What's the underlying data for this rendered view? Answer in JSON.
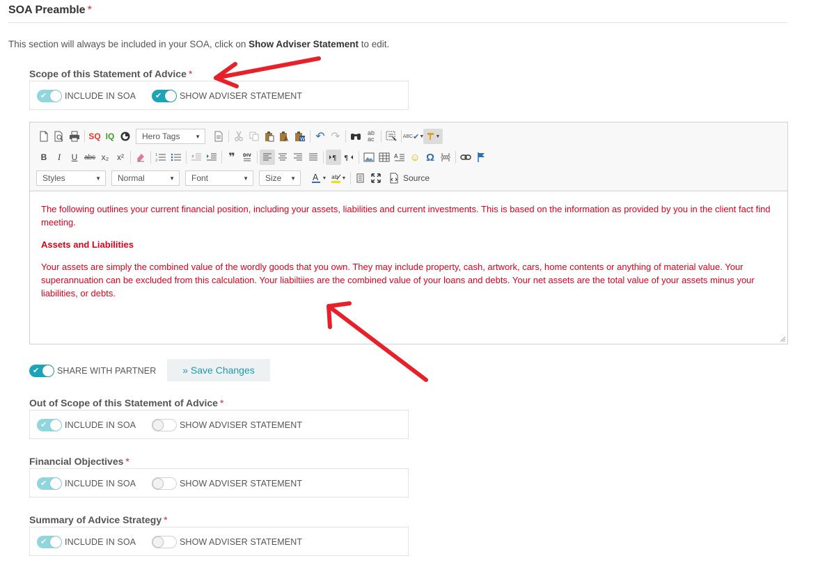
{
  "page": {
    "title": "SOA Preamble",
    "required_mark": "*",
    "intro_before": "This section will always be included in your SOA, click on ",
    "intro_bold": "Show Adviser Statement",
    "intro_after": " to edit."
  },
  "labels": {
    "include": "INCLUDE IN SOA",
    "show_adviser": "SHOW ADVISER STATEMENT",
    "share_partner": "SHARE WITH PARTNER",
    "save_changes": "» Save Changes"
  },
  "sections": [
    {
      "title": "Scope of this Statement of Advice",
      "include_in_soa": true,
      "show_adviser_statement": true
    },
    {
      "title": "Out of Scope of this Statement of Advice",
      "include_in_soa": true,
      "show_adviser_statement": false
    },
    {
      "title": "Financial Objectives",
      "include_in_soa": true,
      "show_adviser_statement": false
    },
    {
      "title": "Summary of Advice Strategy",
      "include_in_soa": true,
      "show_adviser_statement": false
    }
  ],
  "share_with_partner": true,
  "toolbar": {
    "sq": "SQ",
    "iq": "IQ",
    "hero_tags": "Hero Tags",
    "styles": "Styles",
    "format": "Normal",
    "font": "Font",
    "size": "Size",
    "source": "Source",
    "bold": "B",
    "italic": "I",
    "underline": "U",
    "strike": "abc",
    "sub": "x₂",
    "sup": "x²",
    "quote": "❞",
    "omega": "Ω",
    "spell": "ABC"
  },
  "editor": {
    "para1": "The following outlines your current financial position, including your assets, liabilities and current investments. This is based on the information as provided by you in the client fact find meeting.",
    "heading": "Assets and Liabilities",
    "para2": "Your assets are simply the combined value of the wordly goods that you own. They may include property, cash, artwork, cars, home contents or anything of material value. Your superannuation can be excluded from this calculation. Your liabiltiies are the combined value of your loans and debts. Your net assets are the total value of your assets minus your liabilities, or debts."
  },
  "colors": {
    "accent": "#1ca4b8",
    "toggle_light": "#8fd6df",
    "required": "#d9282f",
    "editor_text": "#e0001b",
    "annotation_arrow": "#e8202a"
  }
}
